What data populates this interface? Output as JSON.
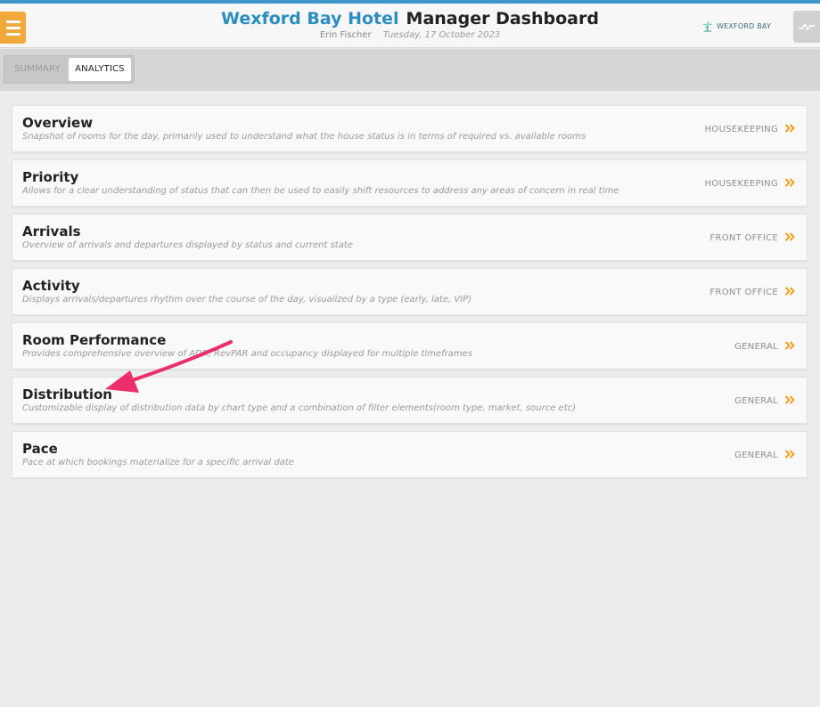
{
  "header": {
    "hotel_name": "Wexford Bay Hotel",
    "dashboard_title": "Manager Dashboard",
    "user": "Erin Fischer",
    "date": "Tuesday, 17 October 2023",
    "brand": "WEXFORD BAY",
    "menu_icon": "hamburger-icon",
    "pulse_icon": "pulse-icon"
  },
  "tabs": [
    {
      "label": "SUMMARY",
      "active": false
    },
    {
      "label": "ANALYTICS",
      "active": true
    }
  ],
  "reports": [
    {
      "title": "Overview",
      "description": "Snapshot of rooms for the day, primarily used to understand what the house status is in terms of required vs. available rooms",
      "category": "HOUSEKEEPING"
    },
    {
      "title": "Priority",
      "description": "Allows for a clear understanding of status that can then be used to easily shift resources to address any areas of concern in real time",
      "category": "HOUSEKEEPING"
    },
    {
      "title": "Arrivals",
      "description": "Overview of arrivals and departures displayed by status and current state",
      "category": "FRONT OFFICE"
    },
    {
      "title": "Activity",
      "description": "Displays arrivals/departures rhythm over the course of the day, visualized by a type (early, late, VIP)",
      "category": "FRONT OFFICE"
    },
    {
      "title": "Room Performance",
      "description": "Provides comprehensive overview of ADR, RevPAR and occupancy displayed for multiple timeframes",
      "category": "GENERAL"
    },
    {
      "title": "Distribution",
      "description": "Customizable display of distribution data by chart type and a combination of filter elements(room type, market, source etc)",
      "category": "GENERAL"
    },
    {
      "title": "Pace",
      "description": "Pace at which bookings materialize for a specific arrival date",
      "category": "GENERAL"
    }
  ],
  "colors": {
    "accent_blue": "#2c8dbe",
    "menu_orange": "#f0a93a",
    "chevron_orange": "#f0a020",
    "annotation_pink": "#ec2f6b"
  }
}
